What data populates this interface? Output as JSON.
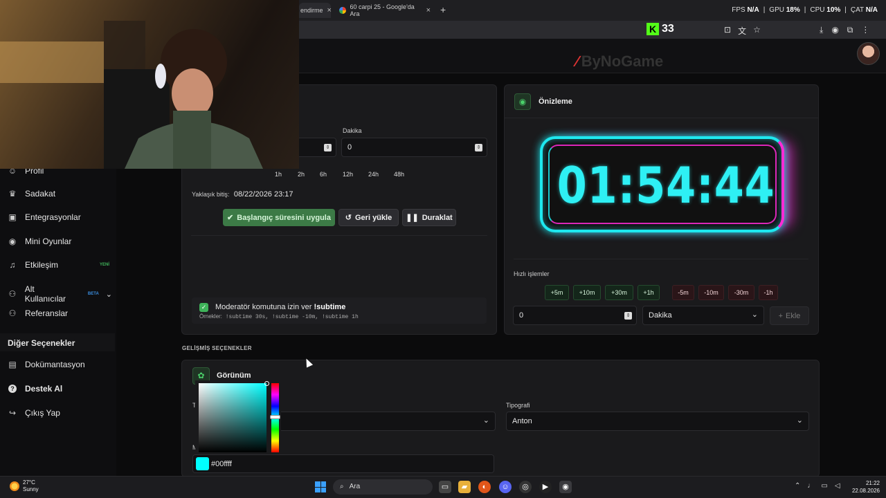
{
  "browser": {
    "tabs": [
      {
        "label": "endirme"
      },
      {
        "label": "60 carpi 25 - Google'da Ara"
      }
    ],
    "new_tab": "+",
    "stats": {
      "fps_label": "FPS",
      "fps": "N/A",
      "gpu_label": "GPU",
      "gpu": "18%",
      "cpu_label": "CPU",
      "cpu": "10%",
      "cat_label": "ÇAT",
      "cat": "N/A"
    },
    "kick_count": "33",
    "kick_logo": "K"
  },
  "app": {
    "logo": "ByNoGame",
    "logo_mark": "∕"
  },
  "sidebar": {
    "items": [
      {
        "label": "Profil",
        "icon": "user-icon",
        "glyph": "☺"
      },
      {
        "label": "Sadakat",
        "icon": "trophy-icon",
        "glyph": "♛"
      },
      {
        "label": "Entegrasyonlar",
        "icon": "plug-icon",
        "glyph": "▣"
      },
      {
        "label": "Mini Oyunlar",
        "icon": "gamepad-icon",
        "glyph": "◉"
      },
      {
        "label": "Etkileşim",
        "icon": "music-icon",
        "glyph": "♫",
        "badge": "YENİ",
        "badge_color": "#3fb35a"
      },
      {
        "label": "Alt Kullanıcılar",
        "icon": "users-icon",
        "glyph": "⚇",
        "badge": "BETA",
        "badge_color": "#3a8dde",
        "chevron": "⌄"
      },
      {
        "label": "Referanslar",
        "icon": "people-icon",
        "glyph": "⚇"
      }
    ],
    "section": "Diğer Seçenekler",
    "other_items": [
      {
        "label": "Dokümantasyon",
        "icon": "document-icon",
        "glyph": "▤"
      },
      {
        "label": "Destek Al",
        "icon": "help-icon",
        "glyph": "?"
      },
      {
        "label": "Çıkış Yap",
        "icon": "logout-icon",
        "glyph": "↪"
      }
    ]
  },
  "timer": {
    "minute_label": "Dakika",
    "hour_value": "",
    "minute_value": "0",
    "presets": [
      "1h",
      "2h",
      "6h",
      "12h",
      "24h",
      "48h"
    ],
    "estimated_end_label": "Yaklaşık bitiş:",
    "estimated_end_value": "08/22/2026 23:17",
    "apply_label": "Başlangıç süresini uygula",
    "restore_label": "Geri yükle",
    "pause_label": "Duraklat",
    "mod_label": "Moderatör komutuna izin ver",
    "mod_command": "!subtime",
    "examples_label": "Örnekler:",
    "examples": "!subtime 30s, !subtime -10m, !subtime 1h"
  },
  "preview": {
    "title": "Önizleme",
    "display": "01:54:44",
    "quick_label": "Hızlı işlemler",
    "add_buttons": [
      "+5m",
      "+10m",
      "+30m",
      "+1h"
    ],
    "sub_buttons": [
      "-5m",
      "-10m",
      "-30m",
      "-1h"
    ],
    "amount_value": "0",
    "unit_value": "Dakika",
    "add_label": "Ekle",
    "accent_cyan": "#1ee8ef",
    "accent_pink": "#ff2bd6"
  },
  "advanced": {
    "section_label": "GELİŞMİŞ SEÇENEKLER",
    "appearance_title": "Görünüm",
    "typography_label": "Tipografi",
    "typography_value": "Anton",
    "color_hex": "#00ffff",
    "hidden_label_1": "T",
    "hidden_label_2": "M"
  },
  "taskbar": {
    "weather_temp": "27°C",
    "weather_desc": "Sunny",
    "search_placeholder": "Ara",
    "time": "21:22",
    "date": "22.08.2026"
  }
}
